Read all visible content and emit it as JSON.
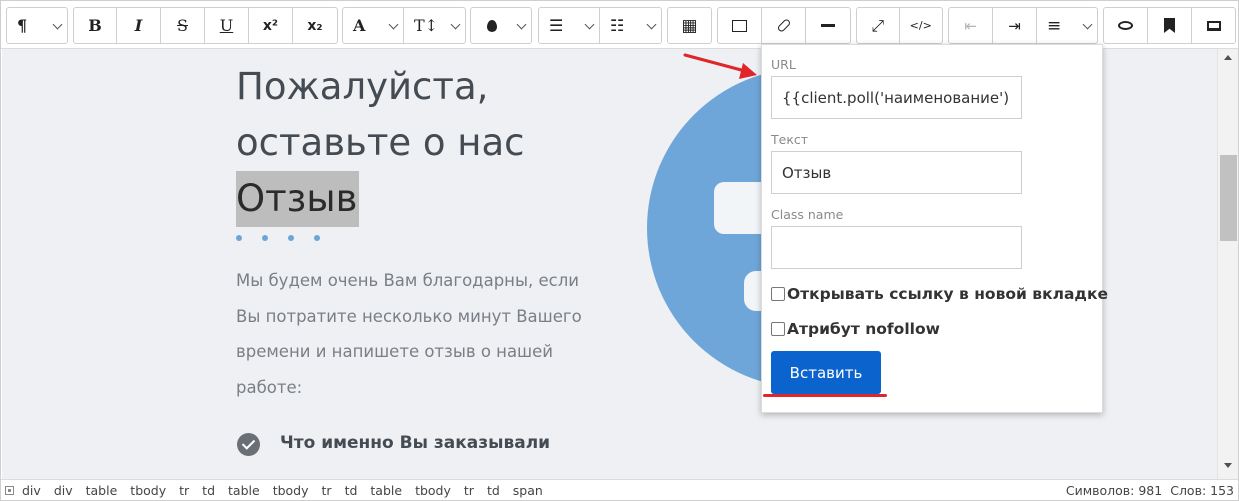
{
  "toolbar": {
    "paragraph": "¶",
    "bold": "B",
    "italic": "I",
    "strike": "S",
    "underline": "U",
    "superscript": "x²",
    "subscript": "x₂",
    "font": "A",
    "font_size": "T↕",
    "color": "💧",
    "ul": "☰",
    "ol": "☷",
    "table": "▦",
    "image": "🖼",
    "link": "🔗",
    "hr": "━",
    "fullscreen": "⤢",
    "source": "</>",
    "outdent": "⇤",
    "indent": "⇥",
    "align": "≡",
    "preview": "👁",
    "bookmark": "🔖",
    "screen": "🖥",
    "icons": [
      "paragraph-icon",
      "bold-icon",
      "italic-icon",
      "strikethrough-icon",
      "underline-icon",
      "superscript-icon",
      "subscript-icon",
      "font-icon",
      "font-size-icon",
      "color-drop-icon",
      "bullet-list-icon",
      "numbered-list-icon",
      "table-icon",
      "image-icon",
      "link-icon",
      "horizontal-rule-icon",
      "fullscreen-icon",
      "source-code-icon",
      "outdent-icon",
      "indent-icon",
      "align-icon",
      "eye-icon",
      "bookmark-icon",
      "monitor-icon"
    ]
  },
  "content": {
    "heading_line1": "Пожалуйста,",
    "heading_line2": "оставьте о нас",
    "heading_highlight": "Отзыв",
    "paragraph": "Мы будем очень Вам благодарны, если Вы потратите несколько минут Вашего времени и напишете отзыв о нашей работе:",
    "list_item": "Что именно Вы заказывали"
  },
  "link_popup": {
    "url_label": "URL",
    "url_value": "{{client.poll('наименование')}}",
    "text_label": "Текст",
    "text_value": "Отзыв",
    "class_label": "Class name",
    "class_value": "",
    "new_tab_label": "Открывать ссылку в новой вкладке",
    "nofollow_label": "Атрибут nofollow",
    "insert_button": "Вставить"
  },
  "statusbar": {
    "path": [
      "div",
      "div",
      "table",
      "tbody",
      "tr",
      "td",
      "table",
      "tbody",
      "tr",
      "td",
      "table",
      "tbody",
      "tr",
      "td",
      "span"
    ],
    "chars": "Символов: 981",
    "words": "Слов: 153"
  },
  "colors": {
    "accent": "#0b63ce",
    "annotation": "#e0262a",
    "circle": "#6fa6d9",
    "highlight": "#bdbdbd"
  }
}
